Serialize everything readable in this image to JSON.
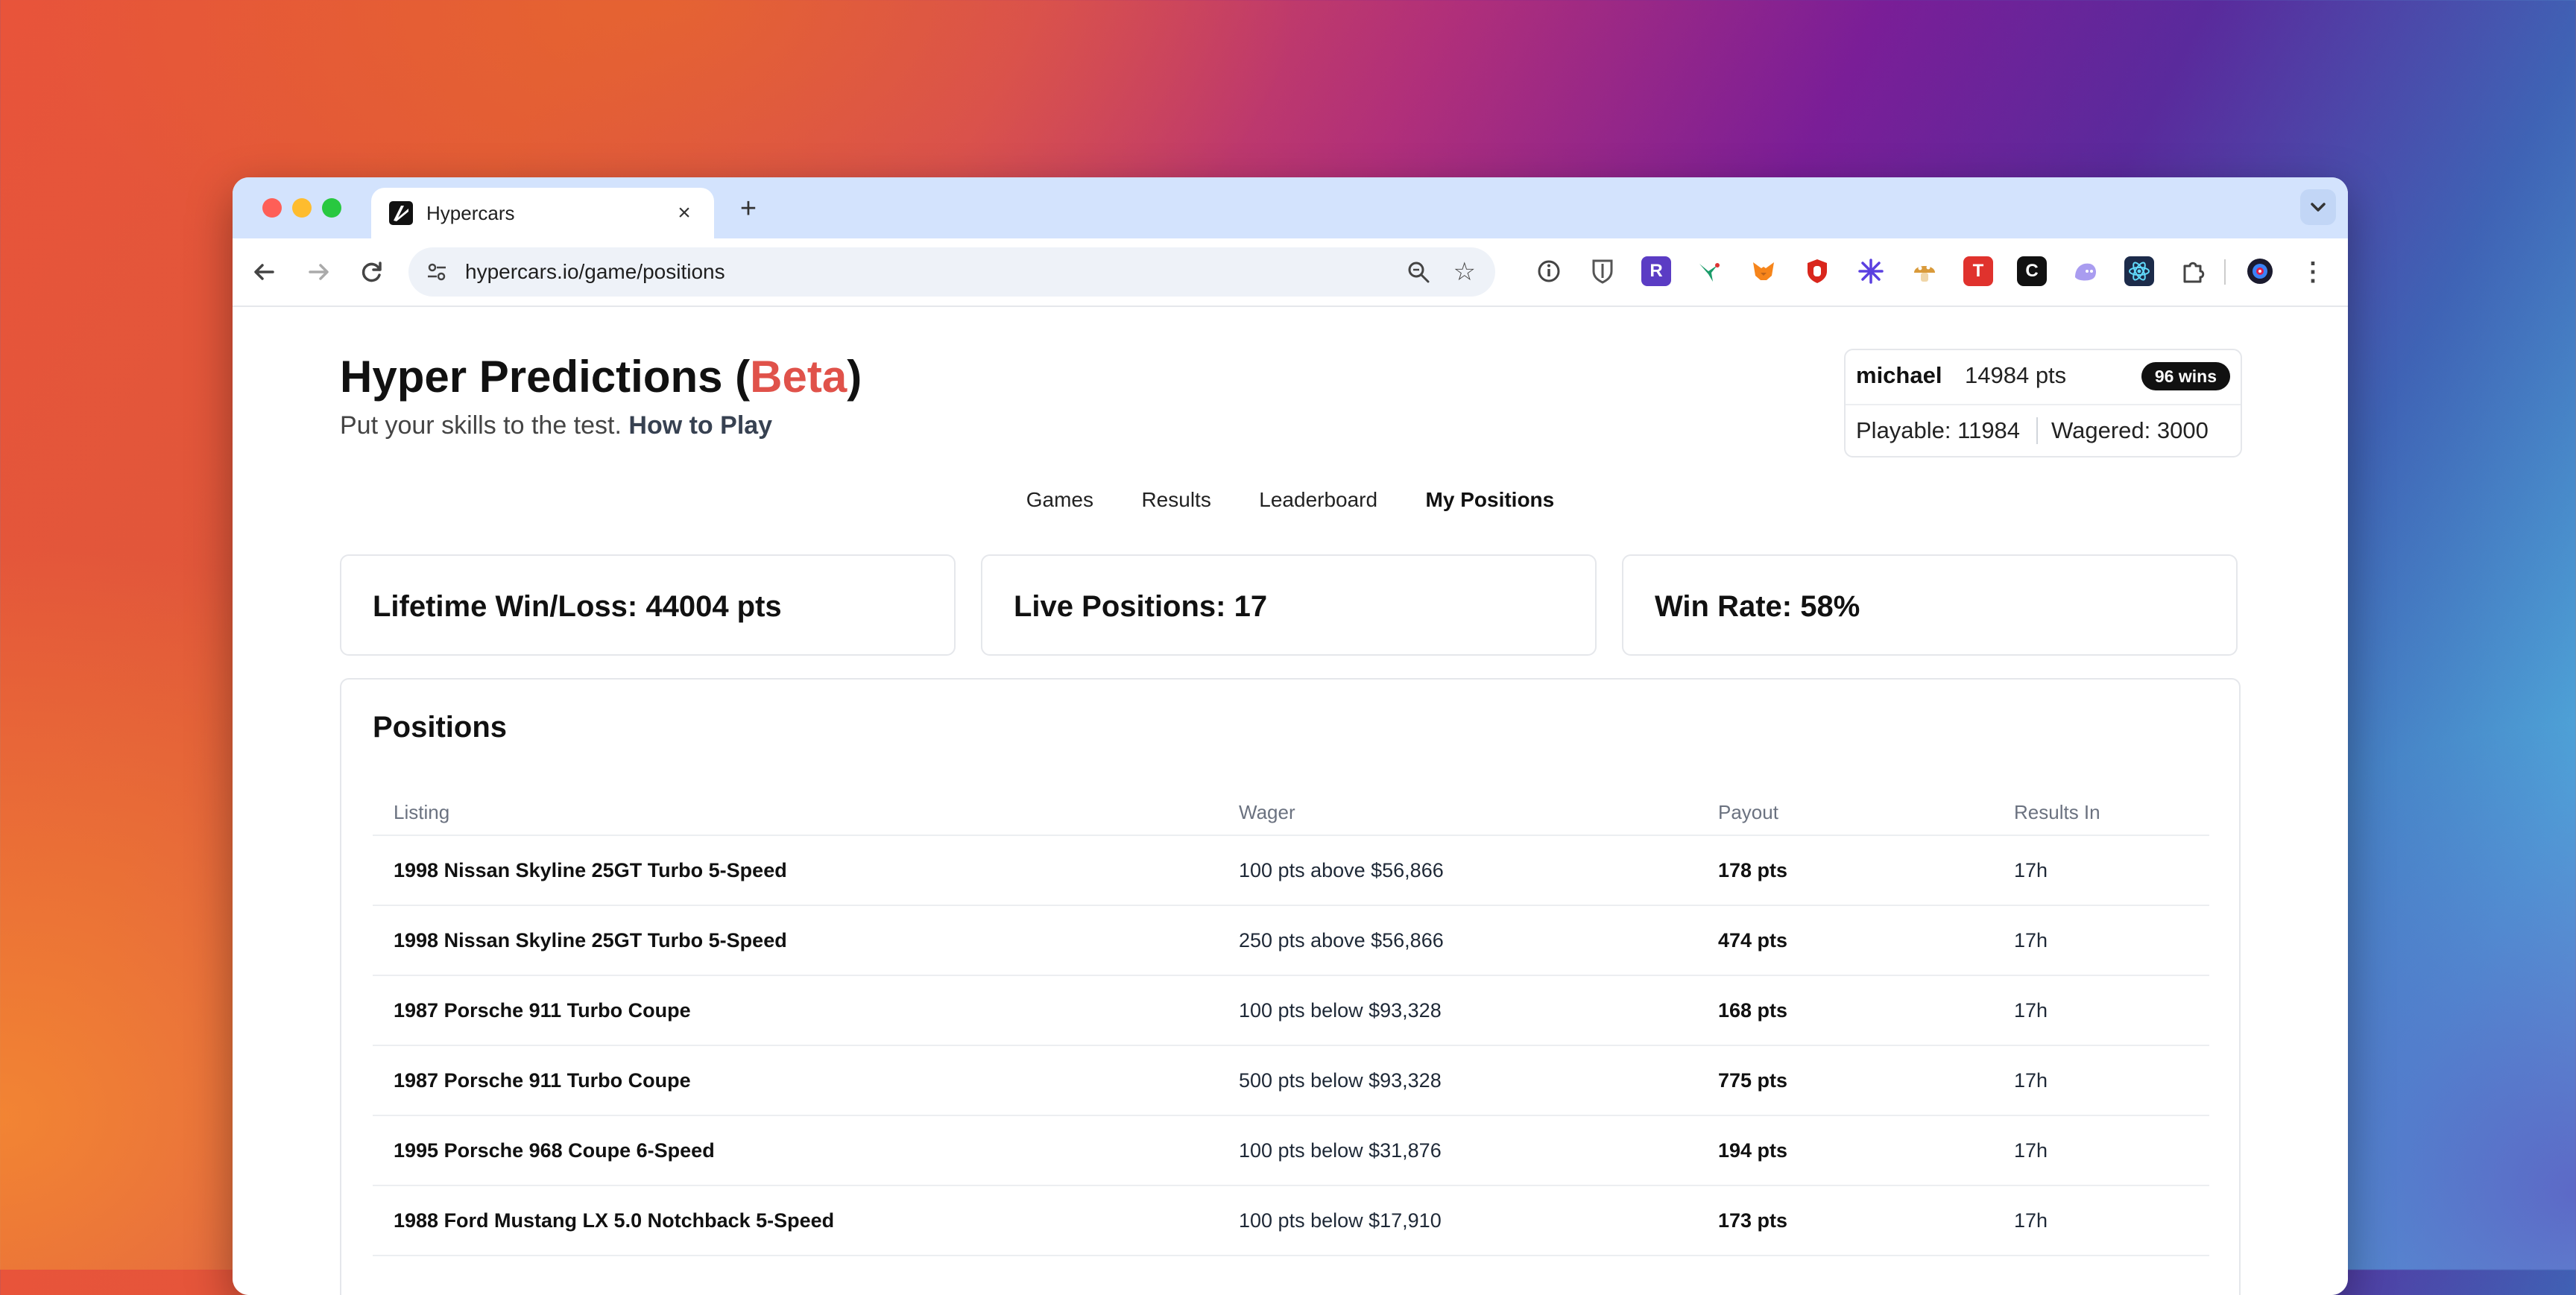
{
  "browser": {
    "tab_title": "Hypercars",
    "url": "hypercars.io/game/positions"
  },
  "header": {
    "title_main": "Hyper Predictions (",
    "title_beta": "Beta",
    "title_close": ")",
    "subtitle": "Put your skills to the test.",
    "how_to_play": "How to Play"
  },
  "user": {
    "name": "michael",
    "points": "14984 pts",
    "wins_badge": "96 wins",
    "playable": "Playable: 11984",
    "wagered": "Wagered: 3000"
  },
  "nav": {
    "games": "Games",
    "results": "Results",
    "leaderboard": "Leaderboard",
    "my_positions": "My Positions"
  },
  "stats": {
    "lifetime": "Lifetime Win/Loss: 44004 pts",
    "live": "Live Positions: 17",
    "win_rate": "Win Rate: 58%"
  },
  "positions": {
    "title": "Positions",
    "columns": [
      "Listing",
      "Wager",
      "Payout",
      "Results In"
    ],
    "rows": [
      {
        "listing": "1998 Nissan Skyline 25GT Turbo 5-Speed",
        "wager": "100 pts above $56,866",
        "payout": "178 pts",
        "results_in": "17h"
      },
      {
        "listing": "1998 Nissan Skyline 25GT Turbo 5-Speed",
        "wager": "250 pts above $56,866",
        "payout": "474 pts",
        "results_in": "17h"
      },
      {
        "listing": "1987 Porsche 911 Turbo Coupe",
        "wager": "100 pts below $93,328",
        "payout": "168 pts",
        "results_in": "17h"
      },
      {
        "listing": "1987 Porsche 911 Turbo Coupe",
        "wager": "500 pts below $93,328",
        "payout": "775 pts",
        "results_in": "17h"
      },
      {
        "listing": "1995 Porsche 968 Coupe 6-Speed",
        "wager": "100 pts below $31,876",
        "payout": "194 pts",
        "results_in": "17h"
      },
      {
        "listing": "1988 Ford Mustang LX 5.0 Notchback 5-Speed",
        "wager": "100 pts below $17,910",
        "payout": "173 pts",
        "results_in": "17h"
      }
    ]
  },
  "extensions": {
    "icons": [
      "info-icon",
      "bitwarden-icon",
      "r-extension-icon",
      "hummingbird-icon",
      "metamask-icon",
      "ublock-icon",
      "sparkle-icon",
      "mushroom-icon",
      "t-extension-icon",
      "c-extension-icon",
      "ghost-icon",
      "react-icon",
      "puzzle-icon",
      "profile-avatar-icon"
    ],
    "r_letter": "R",
    "t_letter": "T",
    "c_letter": "C"
  }
}
